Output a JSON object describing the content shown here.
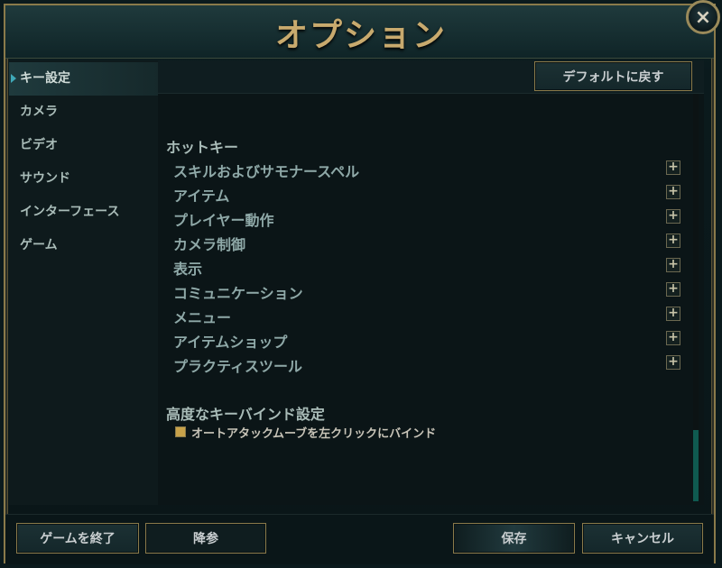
{
  "window": {
    "title": "オプション",
    "close_icon": "×"
  },
  "sidebar": {
    "items": [
      {
        "label": "キー設定",
        "active": true
      },
      {
        "label": "カメラ"
      },
      {
        "label": "ビデオ"
      },
      {
        "label": "サウンド"
      },
      {
        "label": "インターフェース"
      },
      {
        "label": "ゲーム"
      }
    ]
  },
  "toolbar": {
    "reset_label": "デフォルトに戻す"
  },
  "hotkeys": {
    "heading": "ホットキー",
    "rows": [
      {
        "label": "スキルおよびサモナースペル",
        "expand": "+"
      },
      {
        "label": "アイテム",
        "expand": "+"
      },
      {
        "label": "プレイヤー動作",
        "expand": "+"
      },
      {
        "label": "カメラ制御",
        "expand": "+"
      },
      {
        "label": "表示",
        "expand": "+"
      },
      {
        "label": "コミュニケーション",
        "expand": "+"
      },
      {
        "label": "メニュー",
        "expand": "+"
      },
      {
        "label": "アイテムショップ",
        "expand": "+"
      },
      {
        "label": "プラクティスツール",
        "expand": "+"
      }
    ]
  },
  "advanced": {
    "heading": "高度なキーバインド設定",
    "attack_move_label": "オートアタックムーブを左クリックにバインド",
    "attack_move_checked": true
  },
  "footer": {
    "quit_label": "ゲームを終了",
    "surrender_label": "降参",
    "save_label": "保存",
    "cancel_label": "キャンセル"
  },
  "colors": {
    "gold_border": "#8a7a4a",
    "title_gold": "#c8aa6e",
    "scroll_thumb": "#0f5a50"
  }
}
